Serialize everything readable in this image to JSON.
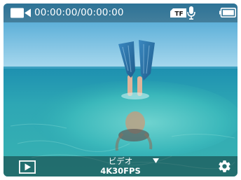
{
  "status_bar": {
    "record_icon": "video-camera-icon",
    "timer": "00:00:00/00:00:00",
    "storage_icon": "tf-card-icon",
    "storage_label": "TF",
    "mic_icon": "microphone-icon",
    "battery_icon": "battery-icon"
  },
  "bottom_bar": {
    "playback_icon": "play-icon",
    "mode_label": "ビデオ",
    "mode_setting": "4K30FPS",
    "mode_dropdown_icon": "dropdown-triangle-icon",
    "settings_icon": "gear-icon"
  },
  "colors": {
    "sky": "#7cc4e6",
    "sea_shallow": "#2fb3bd",
    "sea_deep": "#1b8fa4",
    "fins": "#2d6f9c"
  }
}
